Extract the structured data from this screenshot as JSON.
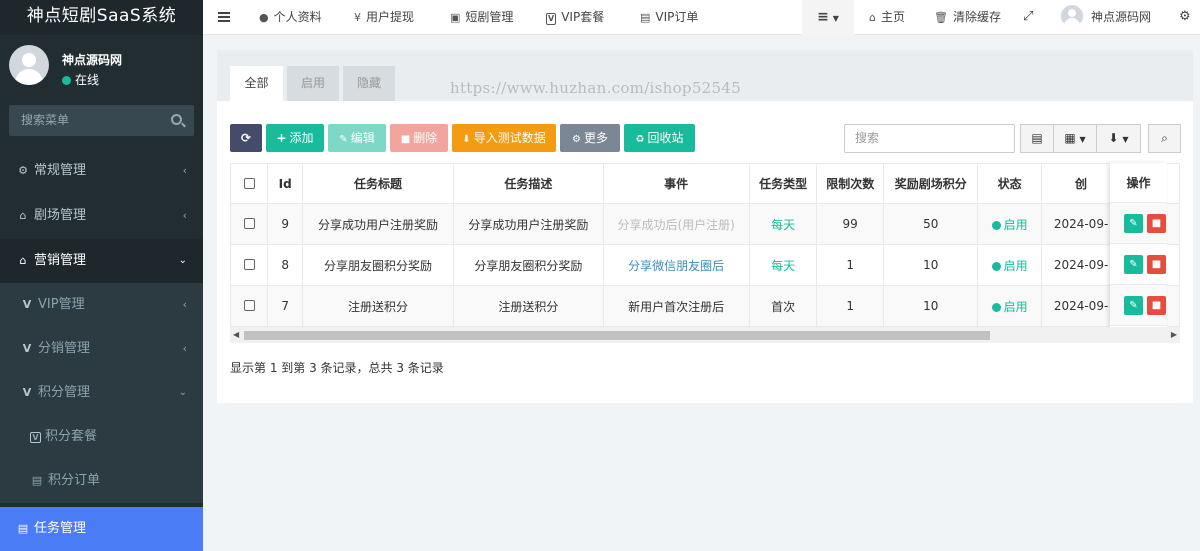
{
  "sidebar": {
    "brand": "神点短剧SaaS系统",
    "user_name": "神点源码网",
    "user_status": "在线",
    "search_placeholder": "搜索菜单",
    "items": [
      {
        "label": "常规管理",
        "icon": "cogs-icon"
      },
      {
        "label": "剧场管理",
        "icon": "home-icon"
      },
      {
        "label": "营销管理",
        "icon": "home-icon"
      },
      {
        "label": "VIP管理",
        "icon": "v-icon"
      },
      {
        "label": "分销管理",
        "icon": "v-icon"
      },
      {
        "label": "积分管理",
        "icon": "v-icon"
      },
      {
        "label": "积分套餐",
        "icon": "vip-box-icon"
      },
      {
        "label": "积分订单",
        "icon": "file-icon"
      },
      {
        "label": "任务管理",
        "icon": "file-icon"
      }
    ]
  },
  "topnav": {
    "items": [
      "个人资料",
      "用户提现",
      "短剧管理",
      "VIP套餐",
      "VIP订单"
    ],
    "icons": [
      "user-icon",
      "yen-icon",
      "shopping-bag-icon",
      "vip-box-icon",
      "file-icon"
    ],
    "right": {
      "home": "主页",
      "clear_cache": "清除缓存",
      "user_name": "神点源码网"
    }
  },
  "watermark": "https://www.huzhan.com/ishop52545",
  "tabs": [
    "全部",
    "启用",
    "隐藏"
  ],
  "toolbar": {
    "add": "添加",
    "edit": "编辑",
    "delete": "删除",
    "import": "导入测试数据",
    "more": "更多",
    "recycle": "回收站",
    "search_placeholder": "搜索"
  },
  "colors": {
    "sidebar_bg": "#222d32",
    "accent_blue": "#4a7cf6",
    "success": "#18bc9c",
    "danger": "#e74c3c",
    "warning": "#f39c12",
    "dark_btn": "#444c69"
  },
  "table": {
    "headers": [
      "Id",
      "任务标题",
      "任务描述",
      "事件",
      "任务类型",
      "限制次数",
      "奖励剧场积分",
      "状态",
      "创",
      "操作"
    ],
    "rows": [
      {
        "id": "9",
        "title": "分享成功用户注册奖励",
        "desc": "分享成功用户注册奖励",
        "event": "分享成功后(用户注册)",
        "type": "每天",
        "limit": "99",
        "points": "50",
        "status": "启用",
        "created": "2024-09-"
      },
      {
        "id": "8",
        "title": "分享朋友圈积分奖励",
        "desc": "分享朋友圈积分奖励",
        "event": "分享微信朋友圈后",
        "type": "每天",
        "limit": "1",
        "points": "10",
        "status": "启用",
        "created": "2024-09-"
      },
      {
        "id": "7",
        "title": "注册送积分",
        "desc": "注册送积分",
        "event": "新用户首次注册后",
        "type": "首次",
        "limit": "1",
        "points": "10",
        "status": "启用",
        "created": "2024-09-"
      }
    ]
  },
  "footer": "显示第 1 到第 3 条记录，总共 3 条记录"
}
